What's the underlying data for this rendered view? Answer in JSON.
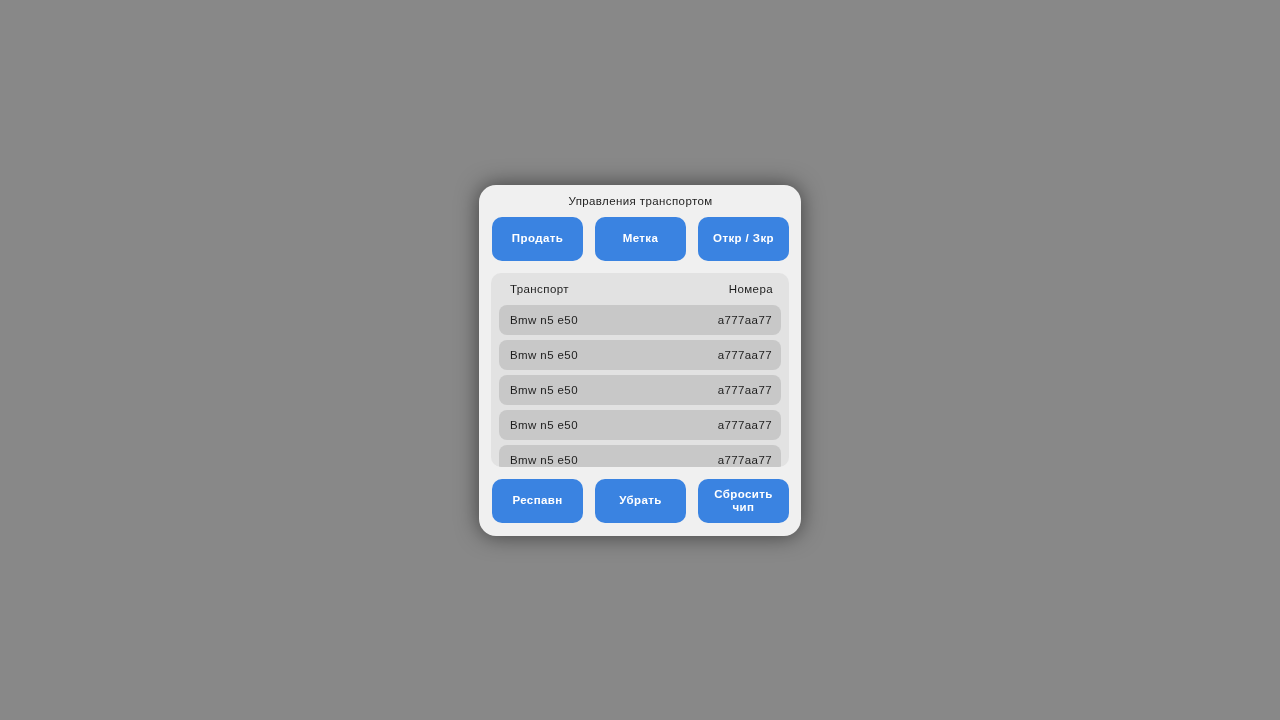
{
  "panel": {
    "title": "Управления транспортом"
  },
  "top_buttons": [
    "Продать",
    "Метка",
    "Откр / Зкр"
  ],
  "vehicle_table": {
    "columns": [
      "Транспорт",
      "Номера"
    ],
    "rows": [
      {
        "vehicle": "Bmw n5 e50",
        "plate": "a777aa77"
      },
      {
        "vehicle": "Bmw n5 e50",
        "plate": "a777aa77"
      },
      {
        "vehicle": "Bmw n5 e50",
        "plate": "a777aa77"
      },
      {
        "vehicle": "Bmw n5 e50",
        "plate": "a777aa77"
      },
      {
        "vehicle": "Bmw n5 e50",
        "plate": "a777aa77"
      }
    ]
  },
  "bottom_buttons": [
    "Респавн",
    "Убрать",
    "Сбросить чип"
  ]
}
